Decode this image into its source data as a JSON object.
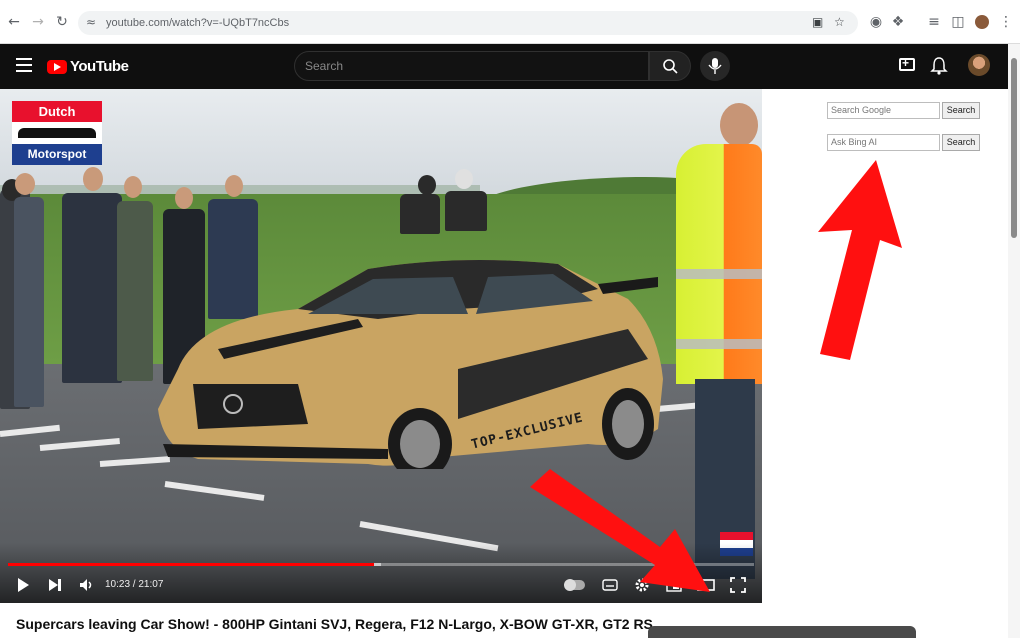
{
  "browser": {
    "url": "youtube.com/watch?v=-UQbT7ncCbs"
  },
  "youtube": {
    "logo_text": "YouTube",
    "search_placeholder": "Search"
  },
  "video": {
    "channel_logo": {
      "top": "Dutch",
      "bottom": "Motorspot"
    },
    "car_livery_text": "TOP-EXCLUSIVE",
    "time_display": "10:23 / 21:07",
    "progress": 0.49,
    "buffered": 0.5
  },
  "right_panel": {
    "google_placeholder": "Search Google",
    "google_button": "Search",
    "bing_placeholder": "Ask Bing AI",
    "bing_button": "Search"
  },
  "title": "Supercars leaving Car Show! - 800HP Gintani SVJ, Regera, F12 N-Largo, X-BOW GT-XR, GT2 RS,...",
  "colors": {
    "youtube_red": "#ff0000",
    "header_bg": "#0f0f0f",
    "annotation_arrow": "#ff0000"
  }
}
